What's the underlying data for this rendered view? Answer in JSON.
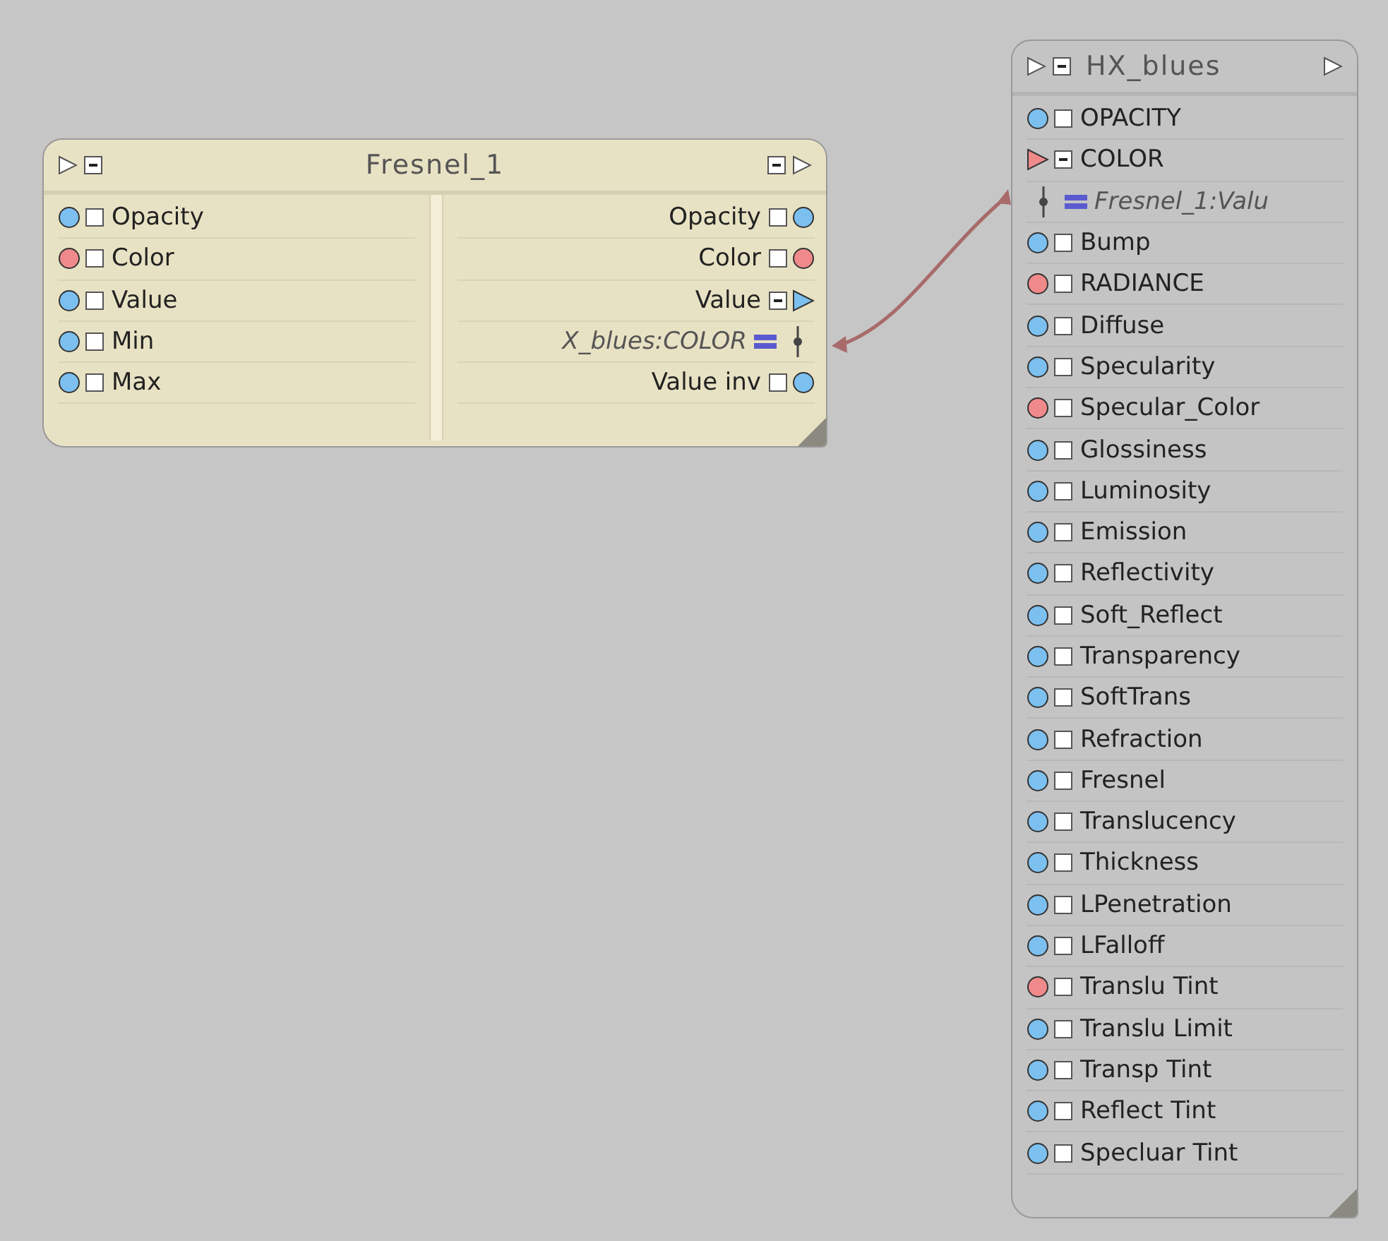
{
  "nodes": [
    {
      "title": "Fresnel_1",
      "kind": "function",
      "inputs": [
        {
          "label": "Opacity",
          "kind": "circle",
          "color": "#7cc0f0",
          "expanded": false
        },
        {
          "label": "Color",
          "kind": "circle",
          "color": "#f08a8a",
          "expanded": false
        },
        {
          "label": "Value",
          "kind": "circle",
          "color": "#7cc0f0",
          "expanded": false
        },
        {
          "label": "Min",
          "kind": "circle",
          "color": "#7cc0f0",
          "expanded": false
        },
        {
          "label": "Max",
          "kind": "circle",
          "color": "#7cc0f0",
          "expanded": false
        }
      ],
      "outputs": [
        {
          "label": "Opacity",
          "kind": "circle",
          "color": "#7cc0f0",
          "expanded": false
        },
        {
          "label": "Color",
          "kind": "circle",
          "color": "#f08a8a",
          "expanded": false
        },
        {
          "label": "Value",
          "kind": "triangle",
          "color": "#7cc0f0",
          "expanded": true
        },
        {
          "label": "X_blues:COLOR",
          "kind": "link"
        },
        {
          "label": "Value inv",
          "kind": "circle",
          "color": "#7cc0f0",
          "expanded": false
        }
      ]
    },
    {
      "title": "HX_blues",
      "kind": "material",
      "inputs": [
        {
          "label": "OPACITY",
          "kind": "circle",
          "color": "#7cc0f0",
          "expanded": false
        },
        {
          "label": "COLOR",
          "kind": "triangle",
          "color": "#f08a8a",
          "expanded": true
        },
        {
          "label": "Fresnel_1:Valu",
          "kind": "link"
        },
        {
          "label": "Bump",
          "kind": "circle",
          "color": "#7cc0f0",
          "expanded": false
        },
        {
          "label": "RADIANCE",
          "kind": "circle",
          "color": "#f08a8a",
          "expanded": false
        },
        {
          "label": "Diffuse",
          "kind": "circle",
          "color": "#7cc0f0",
          "expanded": false
        },
        {
          "label": "Specularity",
          "kind": "circle",
          "color": "#7cc0f0",
          "expanded": false
        },
        {
          "label": "Specular_Color",
          "kind": "circle",
          "color": "#f08a8a",
          "expanded": false
        },
        {
          "label": "Glossiness",
          "kind": "circle",
          "color": "#7cc0f0",
          "expanded": false
        },
        {
          "label": "Luminosity",
          "kind": "circle",
          "color": "#7cc0f0",
          "expanded": false
        },
        {
          "label": "Emission",
          "kind": "circle",
          "color": "#7cc0f0",
          "expanded": false
        },
        {
          "label": "Reflectivity",
          "kind": "circle",
          "color": "#7cc0f0",
          "expanded": false
        },
        {
          "label": "Soft_Reflect",
          "kind": "circle",
          "color": "#7cc0f0",
          "expanded": false
        },
        {
          "label": "Transparency",
          "kind": "circle",
          "color": "#7cc0f0",
          "expanded": false
        },
        {
          "label": "SoftTrans",
          "kind": "circle",
          "color": "#7cc0f0",
          "expanded": false
        },
        {
          "label": "Refraction",
          "kind": "circle",
          "color": "#7cc0f0",
          "expanded": false
        },
        {
          "label": "Fresnel",
          "kind": "circle",
          "color": "#7cc0f0",
          "expanded": false
        },
        {
          "label": "Translucency",
          "kind": "circle",
          "color": "#7cc0f0",
          "expanded": false
        },
        {
          "label": "Thickness",
          "kind": "circle",
          "color": "#7cc0f0",
          "expanded": false
        },
        {
          "label": "LPenetration",
          "kind": "circle",
          "color": "#7cc0f0",
          "expanded": false
        },
        {
          "label": "LFalloff",
          "kind": "circle",
          "color": "#7cc0f0",
          "expanded": false
        },
        {
          "label": "Translu Tint",
          "kind": "circle",
          "color": "#f08a8a",
          "expanded": false
        },
        {
          "label": "Translu Limit",
          "kind": "circle",
          "color": "#7cc0f0",
          "expanded": false
        },
        {
          "label": "Transp Tint",
          "kind": "circle",
          "color": "#7cc0f0",
          "expanded": false
        },
        {
          "label": "Reflect Tint",
          "kind": "circle",
          "color": "#7cc0f0",
          "expanded": false
        },
        {
          "label": "Specluar Tint",
          "kind": "circle",
          "color": "#7cc0f0",
          "expanded": false
        }
      ]
    }
  ]
}
